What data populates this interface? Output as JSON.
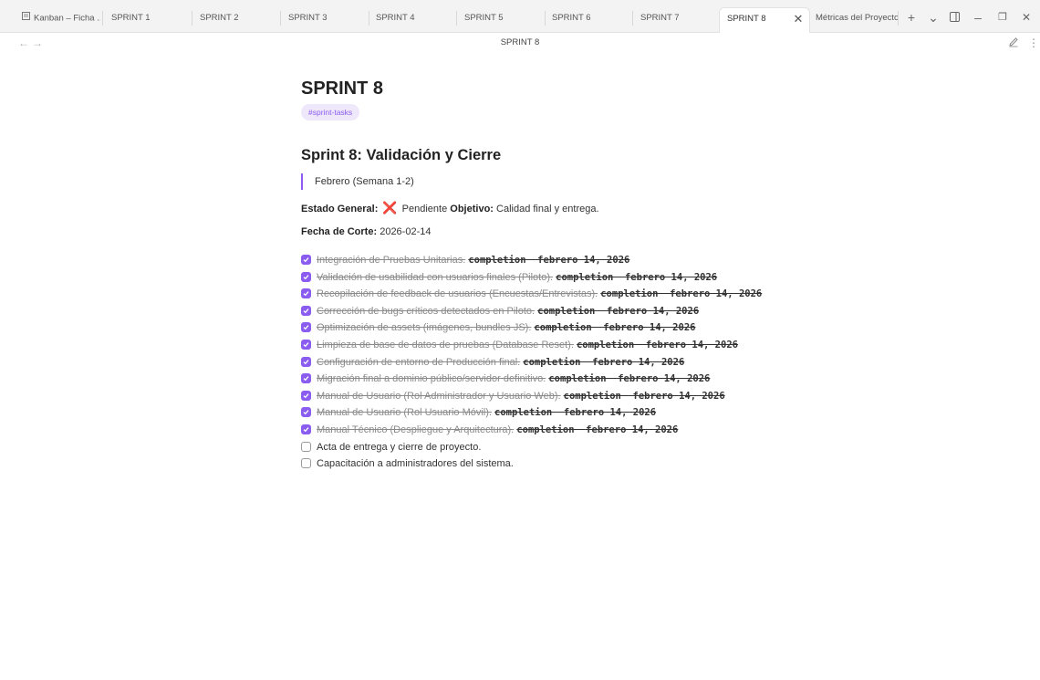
{
  "tabs": [
    {
      "label": "Kanban – Ficha ...",
      "active": false
    },
    {
      "label": "SPRINT 1",
      "active": false
    },
    {
      "label": "SPRINT 2",
      "active": false
    },
    {
      "label": "SPRINT 3",
      "active": false
    },
    {
      "label": "SPRINT 4",
      "active": false
    },
    {
      "label": "SPRINT 5",
      "active": false
    },
    {
      "label": "SPRINT 6",
      "active": false
    },
    {
      "label": "SPRINT 7",
      "active": false
    },
    {
      "label": "SPRINT 8",
      "active": true
    },
    {
      "label": "Métricas del Proyecto",
      "active": false
    }
  ],
  "tabbar_controls": {
    "new_tab": "+",
    "tab_list": "⌄",
    "minimize": "–",
    "restore": "❐",
    "close": "✕"
  },
  "view": {
    "title": "SPRINT 8",
    "back": "←",
    "forward": "→"
  },
  "note": {
    "title": "SPRINT 8",
    "tag": "#sprint-tasks",
    "heading": "Sprint 8: Validación y Cierre",
    "quote": "Febrero (Semana 1-2)",
    "estado_label": "Estado General:",
    "estado_icon": "❌",
    "estado_value": "Pendiente",
    "objetivo_label": "Objetivo:",
    "objetivo_value": "Calidad final y entrega.",
    "fecha_label": "Fecha de Corte:",
    "fecha_value": "2026-02-14"
  },
  "tasks": [
    {
      "text": "Integración de Pruebas Unitarias.",
      "done": true,
      "meta": "completion  febrero 14, 2026"
    },
    {
      "text": "Validación de usabilidad con usuarios finales (Piloto).",
      "done": true,
      "meta": "completion  febrero 14, 2026"
    },
    {
      "text": "Recopilación de feedback de usuarios (Encuestas/Entrevistas).",
      "done": true,
      "meta": "completion  febrero 14, 2026"
    },
    {
      "text": "Corrección de bugs críticos detectados en Piloto.",
      "done": true,
      "meta": "completion  febrero 14, 2026"
    },
    {
      "text": "Optimización de assets (imágenes, bundles JS).",
      "done": true,
      "meta": "completion  febrero 14, 2026"
    },
    {
      "text": "Limpieza de base de datos de pruebas (Database Reset).",
      "done": true,
      "meta": "completion  febrero 14, 2026"
    },
    {
      "text": "Configuración de entorno de Producción final.",
      "done": true,
      "meta": "completion  febrero 14, 2026"
    },
    {
      "text": "Migración final a dominio público/servidor definitivo.",
      "done": true,
      "meta": "completion  febrero 14, 2026"
    },
    {
      "text": "Manual de Usuario (Rol Administrador y Usuario Web).",
      "done": true,
      "meta": "completion  febrero 14, 2026"
    },
    {
      "text": "Manual de Usuario (Rol Usuario Móvil).",
      "done": true,
      "meta": "completion  febrero 14, 2026"
    },
    {
      "text": "Manual Técnico (Despliegue y Arquitectura).",
      "done": true,
      "meta": "completion  febrero 14, 2026"
    },
    {
      "text": "Acta de entrega y cierre de proyecto.",
      "done": false,
      "meta": ""
    },
    {
      "text": "Capacitación a administradores del sistema.",
      "done": false,
      "meta": ""
    }
  ],
  "colors": {
    "accent": "#8a5cf0",
    "tag_bg": "#efe8fb",
    "cross": "#e03131"
  },
  "icons": {
    "tab_doc": "document-icon",
    "edit": "pencil-icon",
    "more": "more-vertical-icon"
  }
}
